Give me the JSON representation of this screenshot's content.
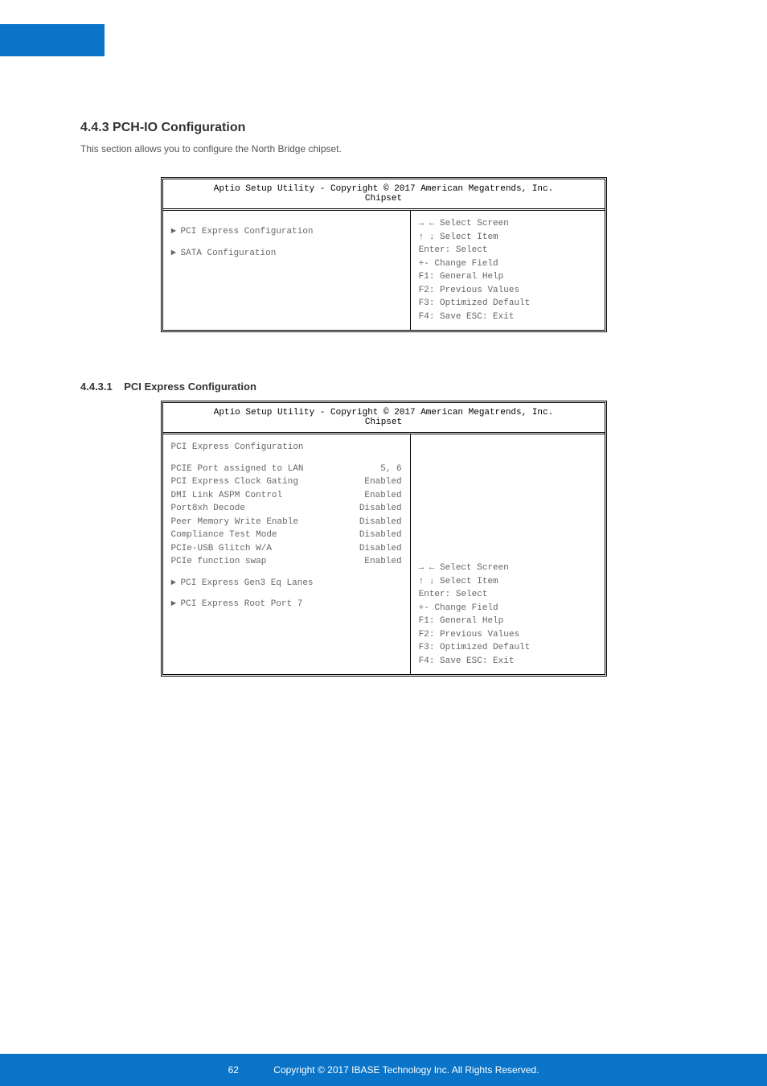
{
  "footer": "Copyright © 2017 IBASE Technology Inc. All Rights Reserved.",
  "page_number": "62",
  "section1": {
    "number": "4.4.3",
    "title": "PCH-IO Configuration",
    "para": "This section allows you to configure the North Bridge chipset."
  },
  "section2": {
    "number": "4.4.3.1",
    "title": "PCI Express Configuration"
  },
  "bios_titles": {
    "setup": "Aptio Setup Utility - Copyright © 2017 American Megatrends, Inc.",
    "tab": "Chipset"
  },
  "help": {
    "l1": "→ ← Select Screen",
    "l2": "↑ ↓ Select Item",
    "l3": "Enter: Select",
    "l4": "+-  Change Field",
    "l5": "F1: General Help",
    "l6": "F2: Previous Values",
    "l7": "F3: Optimized Default",
    "l8": "F4: Save   ESC: Exit"
  },
  "box1": {
    "items": [
      {
        "arrow": "►",
        "label": "PCI Express Configuration"
      },
      {
        "arrow": "►",
        "label": "SATA Configuration"
      }
    ]
  },
  "box2": {
    "header": "PCI Express Configuration",
    "rows": [
      {
        "label": "PCIE Port assigned to LAN",
        "value": "5, 6"
      },
      {
        "label": "PCI Express Clock Gating",
        "value": "Enabled"
      },
      {
        "label": "DMI Link ASPM Control",
        "value": "Enabled"
      },
      {
        "label": "Port8xh Decode",
        "value": "Disabled"
      },
      {
        "label": "Peer Memory Write Enable",
        "value": "Disabled"
      },
      {
        "label": "Compliance Test Mode",
        "value": "Disabled"
      },
      {
        "label": "PCIe-USB Glitch W/A",
        "value": "Disabled"
      },
      {
        "label": "PCIe function swap",
        "value": "Enabled"
      }
    ],
    "arrow_items": [
      {
        "arrow": "►",
        "label": "PCI Express Gen3 Eq Lanes"
      },
      {
        "arrow": "►",
        "label": "PCI Express Root Port 7"
      }
    ]
  }
}
